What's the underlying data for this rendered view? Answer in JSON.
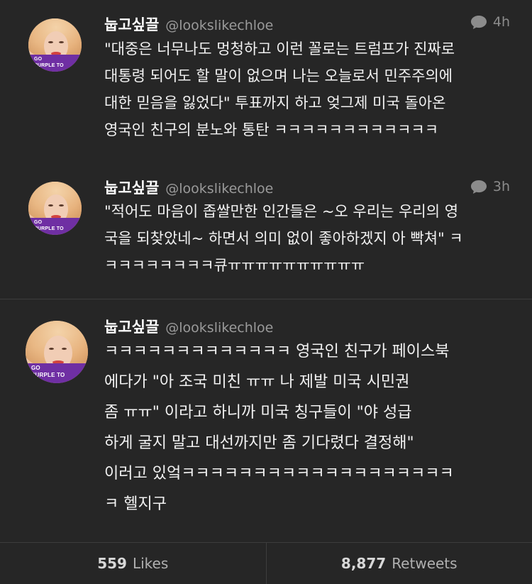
{
  "tweets": [
    {
      "name": "눕고싶끌",
      "handle": "@lookslikechloe",
      "time": "4h",
      "avatar_banner": [
        "GO",
        "PURPLE TO"
      ],
      "lines": [
        "\"대중은 너무나도 멍청하고 이런 꼴로는 트럼프가 진짜로",
        "대통령 되어도 할 말이 없으며 나는 오늘로서 민주주의에",
        "대한 믿음을 잃었다\" 투표까지 하고 엊그제 미국 돌아온",
        "영국인 친구의 분노와 통탄 ㅋㅋㅋㅋㅋㅋㅋㅋㅋㅋㅋㅋ"
      ]
    },
    {
      "name": "눕고싶끌",
      "handle": "@lookslikechloe",
      "time": "3h",
      "avatar_banner": [
        "GO",
        "PURPLE TO"
      ],
      "lines": [
        "\"적어도 마음이 좁쌀만한 인간들은 ~오 우리는 우리의 영",
        "국을 되찾았네~ 하면서 의미 없이 좋아하겠지 아 빡쳐\" ㅋ",
        "ㅋㅋㅋㅋㅋㅋㅋㅋ큐ㅠㅠㅠㅠㅠㅠㅠㅠㅠㅠ"
      ]
    },
    {
      "name": "눕고싶끌",
      "handle": "@lookslikechloe",
      "avatar_banner": [
        "GO",
        "PURPLE TO"
      ],
      "lines": [
        "ㅋㅋㅋㅋㅋㅋㅋㅋㅋㅋㅋㅋㅋ 영국인 친구가 페이스북",
        "에다가 \"아 조국 미친 ㅠㅠ 나 제발 미국 시민권",
        "좀 ㅠㅠ\" 이라고 하니까 미국 칭구들이 \"야 성급",
        "하게 굴지 말고 대선까지만 좀 기다렸다 결정해\"",
        "이러고 있엌ㅋㅋㅋㅋㅋㅋㅋㅋㅋㅋㅋㅋㅋㅋㅋㅋㅋㅋㅋ",
        "ㅋ 헬지구"
      ]
    }
  ],
  "stats": {
    "likes_count": "559",
    "likes_label": "Likes",
    "retweets_count": "8,877",
    "retweets_label": "Retweets"
  },
  "colors": {
    "background": "#262626",
    "text": "#ffffff",
    "muted": "#9a9a9a",
    "banner": "#6f2fa3"
  },
  "icons": {
    "reply_indicator": "speech-bubble-icon"
  }
}
